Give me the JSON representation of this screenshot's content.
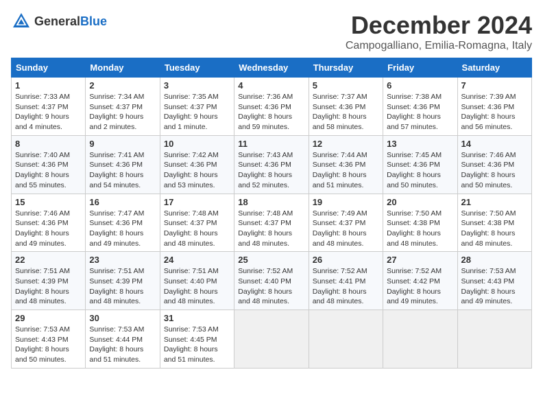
{
  "header": {
    "logo_general": "General",
    "logo_blue": "Blue",
    "month_title": "December 2024",
    "location": "Campogalliano, Emilia-Romagna, Italy"
  },
  "weekdays": [
    "Sunday",
    "Monday",
    "Tuesday",
    "Wednesday",
    "Thursday",
    "Friday",
    "Saturday"
  ],
  "weeks": [
    [
      {
        "day": "1",
        "lines": [
          "Sunrise: 7:33 AM",
          "Sunset: 4:37 PM",
          "Daylight: 9 hours",
          "and 4 minutes."
        ]
      },
      {
        "day": "2",
        "lines": [
          "Sunrise: 7:34 AM",
          "Sunset: 4:37 PM",
          "Daylight: 9 hours",
          "and 2 minutes."
        ]
      },
      {
        "day": "3",
        "lines": [
          "Sunrise: 7:35 AM",
          "Sunset: 4:37 PM",
          "Daylight: 9 hours",
          "and 1 minute."
        ]
      },
      {
        "day": "4",
        "lines": [
          "Sunrise: 7:36 AM",
          "Sunset: 4:36 PM",
          "Daylight: 8 hours",
          "and 59 minutes."
        ]
      },
      {
        "day": "5",
        "lines": [
          "Sunrise: 7:37 AM",
          "Sunset: 4:36 PM",
          "Daylight: 8 hours",
          "and 58 minutes."
        ]
      },
      {
        "day": "6",
        "lines": [
          "Sunrise: 7:38 AM",
          "Sunset: 4:36 PM",
          "Daylight: 8 hours",
          "and 57 minutes."
        ]
      },
      {
        "day": "7",
        "lines": [
          "Sunrise: 7:39 AM",
          "Sunset: 4:36 PM",
          "Daylight: 8 hours",
          "and 56 minutes."
        ]
      }
    ],
    [
      {
        "day": "8",
        "lines": [
          "Sunrise: 7:40 AM",
          "Sunset: 4:36 PM",
          "Daylight: 8 hours",
          "and 55 minutes."
        ]
      },
      {
        "day": "9",
        "lines": [
          "Sunrise: 7:41 AM",
          "Sunset: 4:36 PM",
          "Daylight: 8 hours",
          "and 54 minutes."
        ]
      },
      {
        "day": "10",
        "lines": [
          "Sunrise: 7:42 AM",
          "Sunset: 4:36 PM",
          "Daylight: 8 hours",
          "and 53 minutes."
        ]
      },
      {
        "day": "11",
        "lines": [
          "Sunrise: 7:43 AM",
          "Sunset: 4:36 PM",
          "Daylight: 8 hours",
          "and 52 minutes."
        ]
      },
      {
        "day": "12",
        "lines": [
          "Sunrise: 7:44 AM",
          "Sunset: 4:36 PM",
          "Daylight: 8 hours",
          "and 51 minutes."
        ]
      },
      {
        "day": "13",
        "lines": [
          "Sunrise: 7:45 AM",
          "Sunset: 4:36 PM",
          "Daylight: 8 hours",
          "and 50 minutes."
        ]
      },
      {
        "day": "14",
        "lines": [
          "Sunrise: 7:46 AM",
          "Sunset: 4:36 PM",
          "Daylight: 8 hours",
          "and 50 minutes."
        ]
      }
    ],
    [
      {
        "day": "15",
        "lines": [
          "Sunrise: 7:46 AM",
          "Sunset: 4:36 PM",
          "Daylight: 8 hours",
          "and 49 minutes."
        ]
      },
      {
        "day": "16",
        "lines": [
          "Sunrise: 7:47 AM",
          "Sunset: 4:36 PM",
          "Daylight: 8 hours",
          "and 49 minutes."
        ]
      },
      {
        "day": "17",
        "lines": [
          "Sunrise: 7:48 AM",
          "Sunset: 4:37 PM",
          "Daylight: 8 hours",
          "and 48 minutes."
        ]
      },
      {
        "day": "18",
        "lines": [
          "Sunrise: 7:48 AM",
          "Sunset: 4:37 PM",
          "Daylight: 8 hours",
          "and 48 minutes."
        ]
      },
      {
        "day": "19",
        "lines": [
          "Sunrise: 7:49 AM",
          "Sunset: 4:37 PM",
          "Daylight: 8 hours",
          "and 48 minutes."
        ]
      },
      {
        "day": "20",
        "lines": [
          "Sunrise: 7:50 AM",
          "Sunset: 4:38 PM",
          "Daylight: 8 hours",
          "and 48 minutes."
        ]
      },
      {
        "day": "21",
        "lines": [
          "Sunrise: 7:50 AM",
          "Sunset: 4:38 PM",
          "Daylight: 8 hours",
          "and 48 minutes."
        ]
      }
    ],
    [
      {
        "day": "22",
        "lines": [
          "Sunrise: 7:51 AM",
          "Sunset: 4:39 PM",
          "Daylight: 8 hours",
          "and 48 minutes."
        ]
      },
      {
        "day": "23",
        "lines": [
          "Sunrise: 7:51 AM",
          "Sunset: 4:39 PM",
          "Daylight: 8 hours",
          "and 48 minutes."
        ]
      },
      {
        "day": "24",
        "lines": [
          "Sunrise: 7:51 AM",
          "Sunset: 4:40 PM",
          "Daylight: 8 hours",
          "and 48 minutes."
        ]
      },
      {
        "day": "25",
        "lines": [
          "Sunrise: 7:52 AM",
          "Sunset: 4:40 PM",
          "Daylight: 8 hours",
          "and 48 minutes."
        ]
      },
      {
        "day": "26",
        "lines": [
          "Sunrise: 7:52 AM",
          "Sunset: 4:41 PM",
          "Daylight: 8 hours",
          "and 48 minutes."
        ]
      },
      {
        "day": "27",
        "lines": [
          "Sunrise: 7:52 AM",
          "Sunset: 4:42 PM",
          "Daylight: 8 hours",
          "and 49 minutes."
        ]
      },
      {
        "day": "28",
        "lines": [
          "Sunrise: 7:53 AM",
          "Sunset: 4:43 PM",
          "Daylight: 8 hours",
          "and 49 minutes."
        ]
      }
    ],
    [
      {
        "day": "29",
        "lines": [
          "Sunrise: 7:53 AM",
          "Sunset: 4:43 PM",
          "Daylight: 8 hours",
          "and 50 minutes."
        ]
      },
      {
        "day": "30",
        "lines": [
          "Sunrise: 7:53 AM",
          "Sunset: 4:44 PM",
          "Daylight: 8 hours",
          "and 51 minutes."
        ]
      },
      {
        "day": "31",
        "lines": [
          "Sunrise: 7:53 AM",
          "Sunset: 4:45 PM",
          "Daylight: 8 hours",
          "and 51 minutes."
        ]
      },
      null,
      null,
      null,
      null
    ]
  ]
}
